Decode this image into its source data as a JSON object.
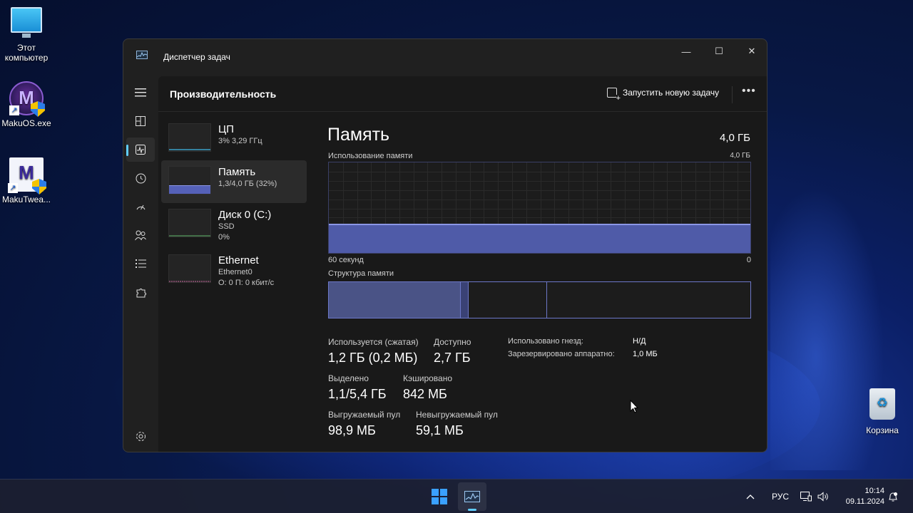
{
  "desktop": {
    "icons": [
      {
        "label": "Этот компьютер",
        "icon": "computer-icon"
      },
      {
        "label": "MakuOS.exe",
        "icon": "makuos-app-icon"
      },
      {
        "label": "MakuTwea...",
        "icon": "makutweaker-app-icon"
      },
      {
        "label": "Корзина",
        "icon": "recycle-bin-icon"
      }
    ]
  },
  "window": {
    "title": "Диспетчер задач",
    "controls": {
      "minimize": "—",
      "maximize": "☐",
      "close": "✕"
    }
  },
  "header": {
    "title": "Производительность",
    "run_task_label": "Запустить новую задачу",
    "more": "•••"
  },
  "devices": [
    {
      "name": "ЦП",
      "line1": "3% 3,29 ГГц",
      "line2": ""
    },
    {
      "name": "Память",
      "line1": "1,3/4,0 ГБ (32%)",
      "line2": ""
    },
    {
      "name": "Диск 0 (C:)",
      "line1": "SSD",
      "line2": "0%"
    },
    {
      "name": "Ethernet",
      "line1": "Ethernet0",
      "line2": "О: 0 П: 0 кбит/с"
    }
  ],
  "memory": {
    "title": "Память",
    "total": "4,0 ГБ",
    "usage_label": "Использование памяти",
    "usage_max": "4,0 ГБ",
    "time_left": "60 секунд",
    "time_right": "0",
    "usage_percent": 32,
    "structure_label": "Структура памяти",
    "stats": {
      "in_use_label": "Используется (сжатая)",
      "in_use_value": "1,2 ГБ (0,2 МБ)",
      "available_label": "Доступно",
      "available_value": "2,7 ГБ",
      "committed_label": "Выделено",
      "committed_value": "1,1/5,4 ГБ",
      "cached_label": "Кэшировано",
      "cached_value": "842 МБ",
      "paged_label": "Выгружаемый пул",
      "paged_value": "98,9 МБ",
      "nonpaged_label": "Невыгружаемый пул",
      "nonpaged_value": "59,1 МБ"
    },
    "details": {
      "slots_label": "Использовано гнезд:",
      "slots_value": "Н/Д",
      "reserved_label": "Зарезервировано аппаратно:",
      "reserved_value": "1,0 МБ"
    }
  },
  "taskbar": {
    "tray_chevron": "^",
    "language": "РУС",
    "time": "10:14",
    "date": "09.11.2024",
    "accent": "#60cdff"
  }
}
